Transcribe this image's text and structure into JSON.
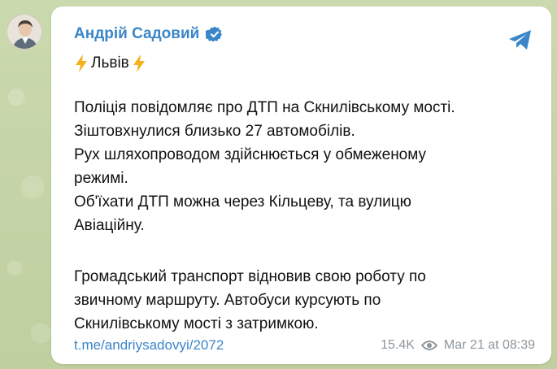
{
  "post": {
    "author": "Андрій Садовий",
    "headline_text": "Львів",
    "paragraph1_lines": [
      "Поліція повідомляє про ДТП на Скнилівському мості.",
      "Зіштовхнулися близько 27 автомобілів.",
      "Рух шляхопроводом здійснюється у обмеженому",
      "режимі.",
      "Об'їхати ДТП можна через Кільцеву, та вулицю",
      "Авіаційну."
    ],
    "paragraph2_lines": [
      "Громадський транспорт відновив свою роботу по",
      "звичному маршруту. Автобуси курсують по",
      "Скнилівському мості з затримкою."
    ],
    "link_text": "t.me/andriysadovyi/2072",
    "views": "15.4K",
    "timestamp": "Mar 21 at 08:39"
  },
  "icons": {
    "verified": "verified-badge-icon",
    "share": "telegram-share-icon",
    "bolt": "lightning-bolt-icon",
    "views": "eye-icon"
  },
  "colors": {
    "accent": "#3a86c9",
    "bubble": "#ffffff",
    "background": "#c4d3a6",
    "meta_text": "#8e969c",
    "bolt": "#f3b11c"
  }
}
